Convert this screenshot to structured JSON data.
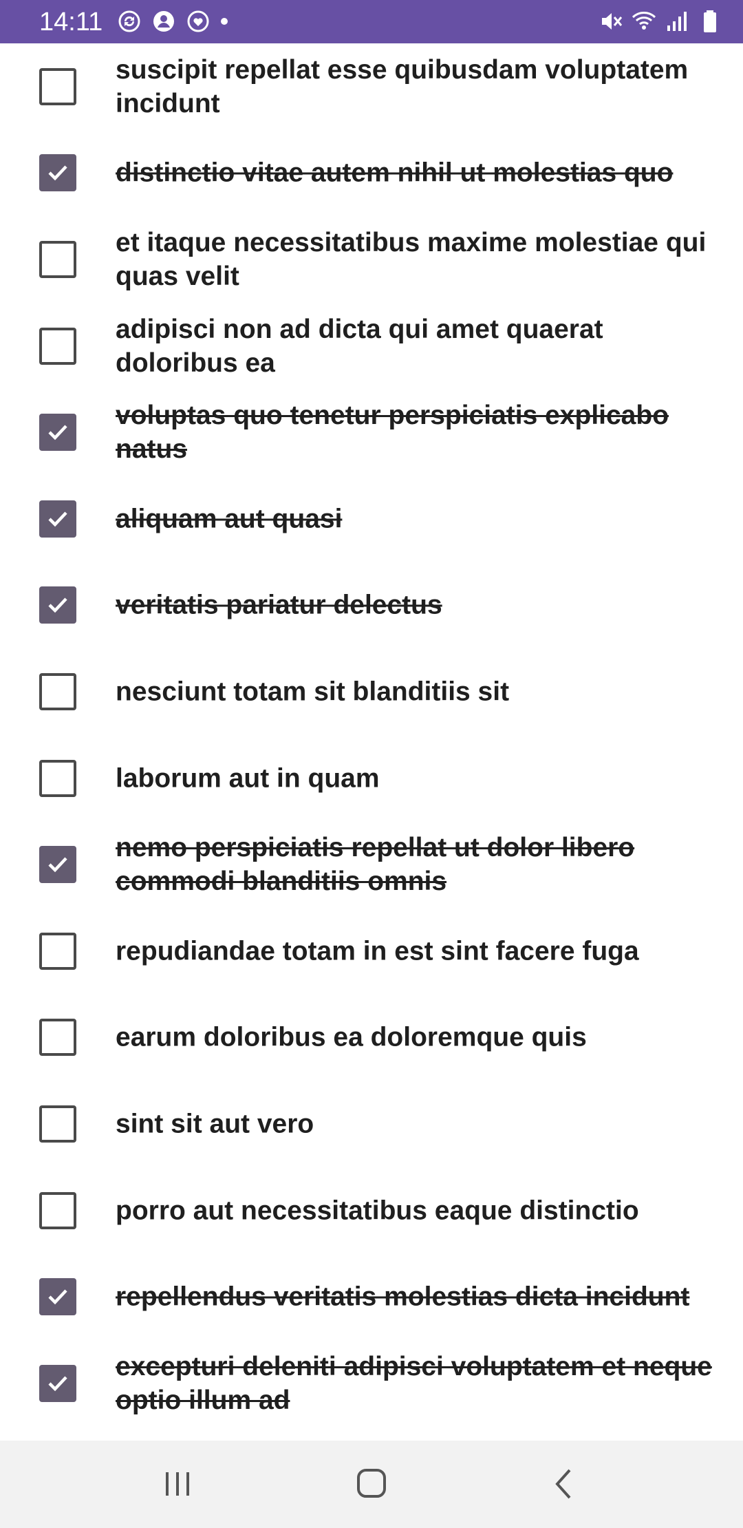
{
  "status_bar": {
    "time": "14:11",
    "background": "#6750a4",
    "left_icons": [
      "sync-icon",
      "account-icon",
      "heart-message-icon",
      "dot-icon"
    ],
    "right_icons": [
      "mute-icon",
      "wifi-icon",
      "signal-icon",
      "battery-icon"
    ]
  },
  "todos": [
    {
      "text": "suscipit repellat esse quibusdam voluptatem incidunt",
      "checked": false
    },
    {
      "text": "distinctio vitae autem nihil ut molestias quo",
      "checked": true
    },
    {
      "text": "et itaque necessitatibus maxime molestiae qui quas velit",
      "checked": false
    },
    {
      "text": "adipisci non ad dicta qui amet quaerat doloribus ea",
      "checked": false
    },
    {
      "text": "voluptas quo tenetur perspiciatis explicabo natus",
      "checked": true
    },
    {
      "text": "aliquam aut quasi",
      "checked": true
    },
    {
      "text": "veritatis pariatur delectus",
      "checked": true
    },
    {
      "text": "nesciunt totam sit blanditiis sit",
      "checked": false
    },
    {
      "text": "laborum aut in quam",
      "checked": false
    },
    {
      "text": "nemo perspiciatis repellat ut dolor libero commodi blanditiis omnis",
      "checked": true
    },
    {
      "text": "repudiandae totam in est sint facere fuga",
      "checked": false
    },
    {
      "text": "earum doloribus ea doloremque quis",
      "checked": false
    },
    {
      "text": "sint sit aut vero",
      "checked": false
    },
    {
      "text": "porro aut necessitatibus eaque distinctio",
      "checked": false
    },
    {
      "text": "repellendus veritatis molestias dicta incidunt",
      "checked": true
    },
    {
      "text": "excepturi deleniti adipisci voluptatem et neque optio illum ad",
      "checked": true
    }
  ],
  "colors": {
    "accent": "#6750a4",
    "checkbox_checked": "#635b70",
    "text": "#1f1f1f"
  },
  "nav_bar": {
    "buttons": [
      "recents-icon",
      "home-icon",
      "back-icon"
    ]
  }
}
